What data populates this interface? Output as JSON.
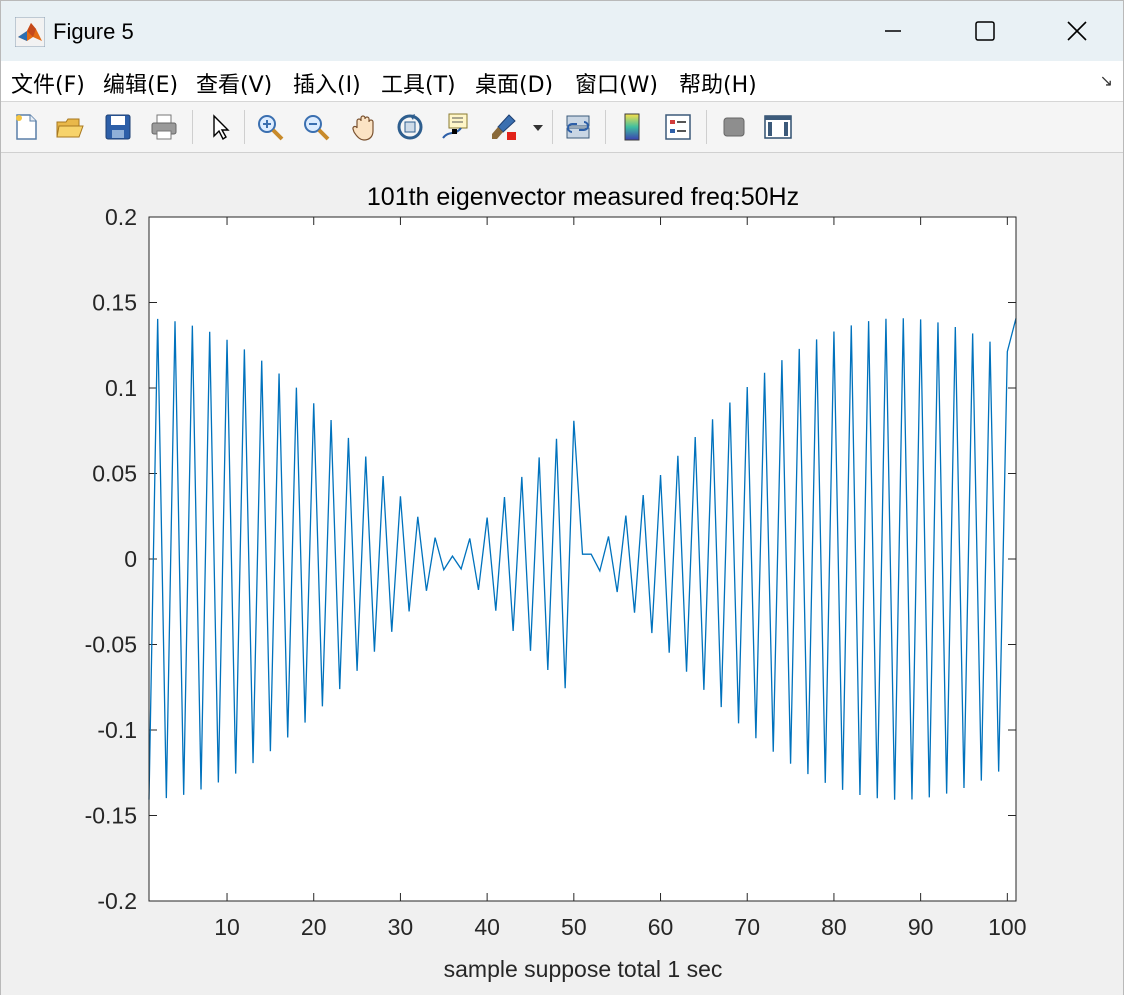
{
  "window": {
    "title": "Figure 5",
    "icon": "matlab-icon"
  },
  "menu": [
    {
      "label": "文件(F)"
    },
    {
      "label": "编辑(E)"
    },
    {
      "label": "查看(V)"
    },
    {
      "label": "插入(I)"
    },
    {
      "label": "工具(T)"
    },
    {
      "label": "桌面(D)"
    },
    {
      "label": "窗口(W)"
    },
    {
      "label": "帮助(H)"
    }
  ],
  "toolbar": [
    "new-figure-icon",
    "open-file-icon",
    "save-icon",
    "print-icon",
    "edit-plot-arrow-icon",
    "zoom-in-icon",
    "zoom-out-icon",
    "pan-icon",
    "rotate-3d-icon",
    "data-cursor-icon",
    "brush-icon",
    "link-plot-icon",
    "colorbar-icon",
    "legend-icon",
    "hide-plot-tools-icon",
    "show-plot-tools-icon"
  ],
  "colors": {
    "line": "#0072bd",
    "axes": "#262626",
    "figure_bg": "#f0f0f0"
  },
  "chart_data": {
    "type": "line",
    "title": "101th eigenvector measured freq:50Hz",
    "xlabel": "sample suppose total 1 sec",
    "ylabel": "",
    "xlim": [
      1,
      101
    ],
    "ylim": [
      -0.2,
      0.2
    ],
    "xticks": [
      10,
      20,
      30,
      40,
      50,
      60,
      70,
      80,
      90,
      100
    ],
    "yticks": [
      -0.2,
      -0.15,
      -0.1,
      -0.05,
      0,
      0.05,
      0.1,
      0.15,
      0.2
    ],
    "ytick_labels": [
      "-0.2",
      "-0.15",
      "-0.1",
      "-0.05",
      "0",
      "0.05",
      "0.1",
      "0.15",
      "0.2"
    ],
    "grid": false,
    "series": [
      {
        "x": [
          1,
          2,
          3,
          4,
          5,
          6,
          7,
          8,
          9,
          10,
          11,
          12,
          13,
          14,
          15,
          16,
          17,
          18,
          19,
          20,
          21,
          22,
          23,
          24,
          25,
          26,
          27,
          28,
          29,
          30,
          31,
          32,
          33,
          34,
          35,
          36,
          37,
          38,
          39,
          40,
          41,
          42,
          43,
          44,
          45,
          46,
          47,
          48,
          49,
          50,
          51,
          52,
          53,
          54,
          55,
          56,
          57,
          58,
          59,
          60,
          61,
          62,
          63,
          64,
          65,
          66,
          67,
          68,
          69,
          70,
          71,
          72,
          73,
          74,
          75,
          76,
          77,
          78,
          79,
          80,
          81,
          82,
          83,
          84,
          85,
          86,
          87,
          88,
          89,
          90,
          91,
          92,
          93,
          94,
          95,
          96,
          97,
          98,
          99,
          100,
          101
        ],
        "y": [
          -0.1407,
          0.1404,
          -0.1398,
          0.139,
          -0.1379,
          0.1365,
          -0.1348,
          0.1329,
          -0.1307,
          0.1282,
          -0.1255,
          0.1226,
          -0.1194,
          0.116,
          -0.1124,
          0.1085,
          -0.1044,
          0.1002,
          -0.0957,
          0.0911,
          -0.0862,
          0.0813,
          -0.0761,
          0.0708,
          -0.0654,
          0.0599,
          -0.0542,
          0.0485,
          -0.0426,
          0.0367,
          -0.0307,
          0.0247,
          -0.0186,
          0.0125,
          -0.0063,
          0.0017,
          -0.0058,
          0.012,
          -0.0181,
          0.0242,
          -0.0302,
          0.0362,
          -0.0421,
          0.048,
          -0.0537,
          0.0594,
          -0.0649,
          0.0703,
          -0.0756,
          0.0808,
          0.0028,
          0.0028,
          -0.007,
          0.0132,
          -0.0193,
          0.0254,
          -0.0314,
          0.0374,
          -0.0433,
          0.0491,
          -0.0548,
          0.0604,
          -0.0659,
          0.0713,
          -0.0765,
          0.0817,
          -0.0866,
          0.0915,
          -0.0961,
          0.1006,
          -0.1048,
          0.1089,
          -0.1127,
          0.1163,
          -0.1197,
          0.1229,
          -0.1258,
          0.1284,
          -0.1309,
          0.133,
          -0.135,
          0.1366,
          -0.138,
          0.1391,
          -0.1399,
          0.1405,
          -0.1408,
          0.1408,
          -0.1406,
          0.1401,
          -0.1394,
          0.1384,
          -0.1372,
          0.1357,
          -0.1339,
          0.1319,
          -0.1296,
          0.1271,
          -0.1243,
          0.1213,
          0.1408
        ]
      }
    ]
  }
}
